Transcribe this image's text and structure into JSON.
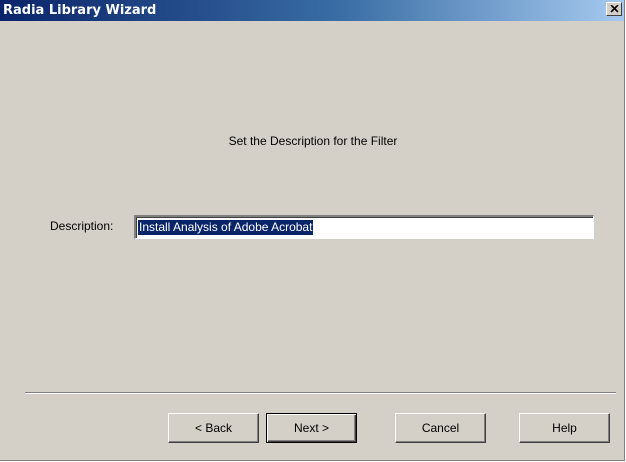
{
  "window": {
    "title": "Radia Library Wizard",
    "close_icon": "close-icon"
  },
  "content": {
    "heading": "Set the Description for the Filter",
    "description_label": "Description:",
    "description_value": "Install Analysis of Adobe Acrobat"
  },
  "buttons": {
    "back": "< Back",
    "next": "Next >",
    "cancel": "Cancel",
    "help": "Help"
  },
  "colors": {
    "title_bar_start": "#0a246a",
    "title_bar_end": "#a6caf0",
    "window_bg": "#d4d0c8",
    "selection": "#0a246a"
  }
}
